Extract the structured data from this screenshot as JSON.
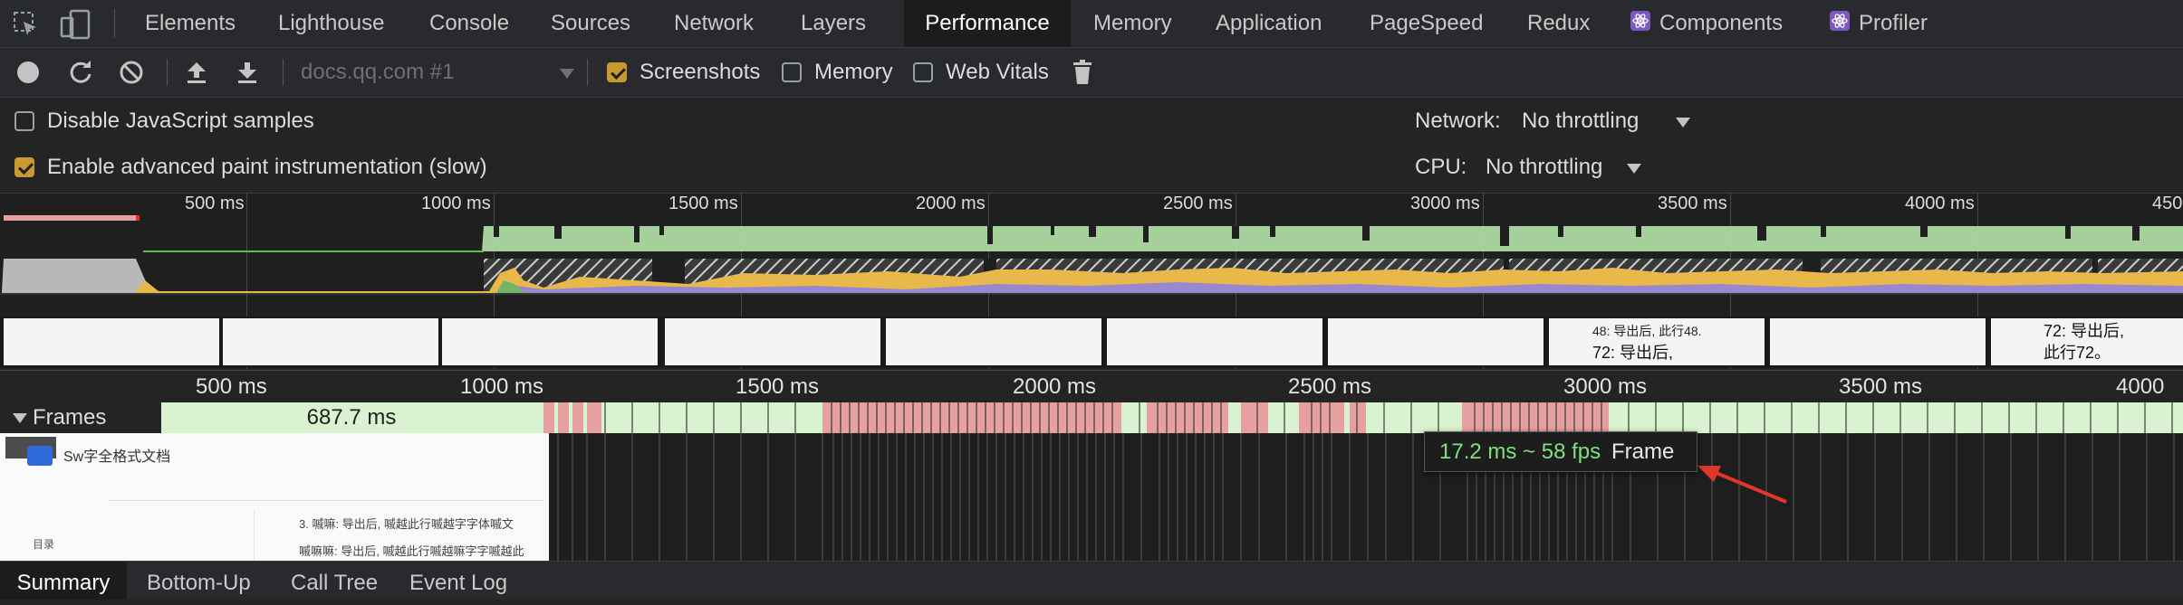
{
  "tabbar": {
    "tabs": [
      {
        "label": "Elements"
      },
      {
        "label": "Lighthouse"
      },
      {
        "label": "Console"
      },
      {
        "label": "Sources"
      },
      {
        "label": "Network"
      },
      {
        "label": "Layers"
      },
      {
        "label": "Performance"
      },
      {
        "label": "Memory"
      },
      {
        "label": "Application"
      },
      {
        "label": "PageSpeed"
      },
      {
        "label": "Redux"
      },
      {
        "label": "Components"
      },
      {
        "label": "Profiler"
      }
    ],
    "active_tab": "Performance"
  },
  "toolbar": {
    "target": "docs.qq.com #1",
    "screenshots_label": "Screenshots",
    "screenshots_checked": true,
    "memory_label": "Memory",
    "memory_checked": false,
    "webvitals_label": "Web Vitals",
    "webvitals_checked": false
  },
  "settings": {
    "disable_js_label": "Disable JavaScript samples",
    "disable_js_checked": false,
    "paint_label": "Enable advanced paint instrumentation (slow)",
    "paint_checked": true,
    "network_label": "Network:",
    "network_value": "No throttling",
    "cpu_label": "CPU:",
    "cpu_value": "No throttling"
  },
  "overview": {
    "ticks": [
      "500 ms",
      "1000 ms",
      "1500 ms",
      "2000 ms",
      "2500 ms",
      "3000 ms",
      "3500 ms",
      "4000 ms",
      "450"
    ]
  },
  "main": {
    "ticks": [
      "500 ms",
      "1000 ms",
      "1500 ms",
      "2000 ms",
      "2500 ms",
      "3000 ms",
      "3500 ms",
      "4000 ms"
    ],
    "frames_label": "Frames",
    "first_frame_duration": "687.7 ms"
  },
  "tooltip": {
    "fps_text": "17.2 ms ~ 58 fps",
    "kind": "Frame"
  },
  "screenshot_preview": {
    "doc_title": "Sw字全格式文档",
    "thumb_lines": [
      "48: 导出后, 此行48.",
      "72: 导出后,",
      "72: 导出后,",
      "此行72。"
    ],
    "side_label": "目录",
    "content_line_1": "3. 嘁嘛: 导出后, 嘁越此行嘁越字字体嘁文",
    "content_line_2": "嘁嘛嘛: 导出后, 嘁越此行嘁越嘛字字嘁越此"
  },
  "bottom_tabs": [
    {
      "label": "Summary"
    },
    {
      "label": "Bottom-Up"
    },
    {
      "label": "Call Tree"
    },
    {
      "label": "Event Log"
    }
  ],
  "colors": {
    "accent_active_tab_bg": "#1c1c1c",
    "checkbox_checked": "#c99a2e",
    "fps_green": "#b5e3a8",
    "frame_red": "#e6a0a0",
    "scripting_yellow": "#e8b84a",
    "rendering_purple": "#9a88cf",
    "painting_green": "#73b36a",
    "tooltip_fps_text": "#7ee07e",
    "arrow_red": "#e0362c"
  }
}
